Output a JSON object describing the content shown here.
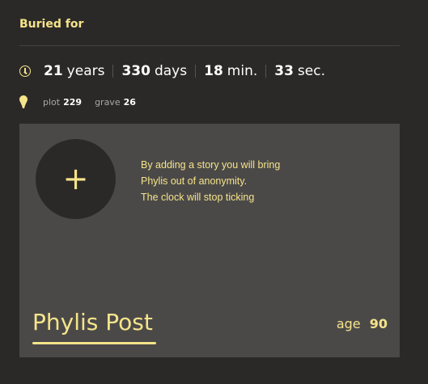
{
  "header": {
    "title": "Buried for"
  },
  "elapsed": {
    "icon": "clock-icon",
    "years_value": "21",
    "years_unit": "years",
    "days_value": "330",
    "days_unit": "days",
    "minutes_value": "18",
    "minutes_unit": "min.",
    "seconds_value": "33",
    "seconds_unit": "sec."
  },
  "location": {
    "icon": "map-pin-icon",
    "plot_label": "plot",
    "plot_value": "229",
    "grave_label": "grave",
    "grave_value": "26"
  },
  "card": {
    "add_button_icon": "plus-icon",
    "add_button_symbol": "+",
    "prompt_lines": [
      "By adding a story you will bring",
      "Phylis out of anonymity.",
      "The clock will stop ticking"
    ],
    "name": "Phylis Post",
    "age_label": "age",
    "age_value": "90"
  },
  "colors": {
    "background": "#2b2928",
    "card": "#4b4948",
    "accent": "#f5e48a",
    "text": "#ffffff",
    "muted": "#a9a6a2"
  }
}
